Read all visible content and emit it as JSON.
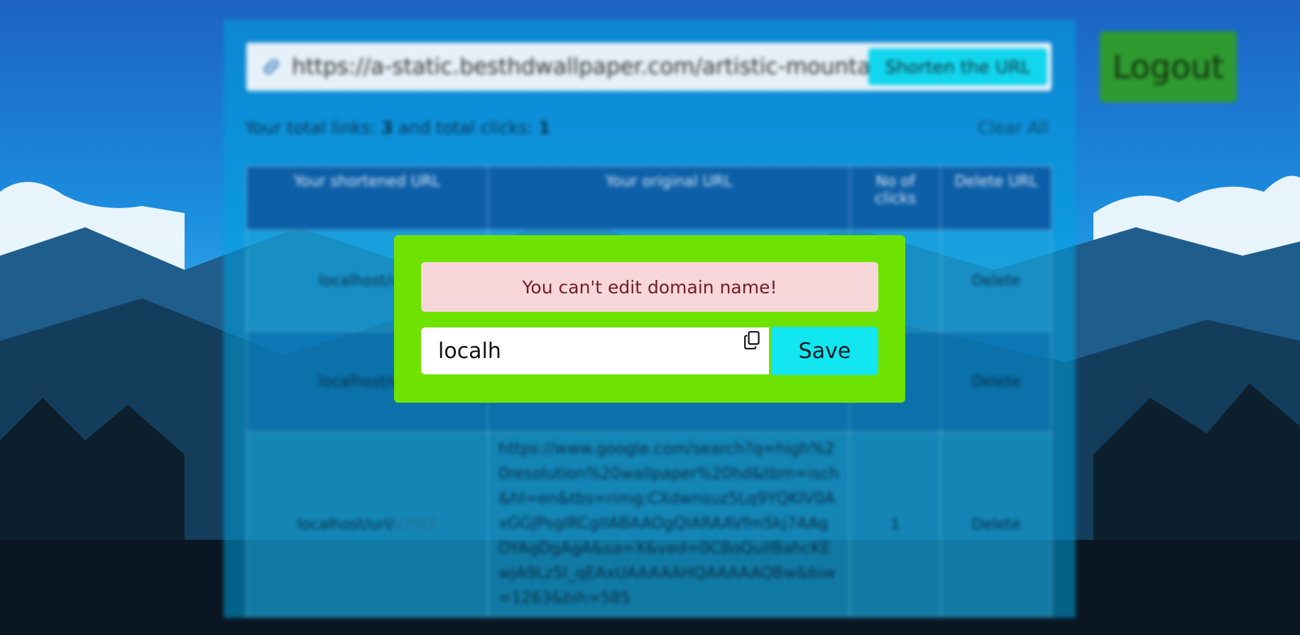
{
  "url_input": {
    "value": "https://a-static.besthdwallpaper.com/artistic-mountains"
  },
  "shorten_button_label": "Shorten the URL",
  "logout_label": "Logout",
  "stats": {
    "prefix": "Your total links: ",
    "links": "3",
    "middle": " and total clicks: ",
    "clicks": "1"
  },
  "clear_all_label": "Clear All",
  "table": {
    "headers": [
      "Your shortened URL",
      "Your original URL",
      "No of clicks",
      "Delete URL"
    ],
    "rows": [
      {
        "short_host": "localhost/url/",
        "short_code": "",
        "original": "",
        "clicks": "",
        "delete": "Delete"
      },
      {
        "short_host": "localhost/url/",
        "short_code": "",
        "original": "",
        "clicks": "",
        "delete": "Delete"
      },
      {
        "short_host": "localhost/url/",
        "short_code": "a75f2",
        "original": "https://www.google.com/search?q=high%20resolution%20wallpaper%20hd&tbm=isch&hl=en&tbs=rimg:CXdwnsuz5Lq9YQKIV0AxGGJPsgIRCgIIABAAOgQIARAAVfmSkj7AAgDYAgDgAgA&sa=X&ved=0CBoQuIIBahcKEwjA9Lz5I_qEAxUAAAAAHQAAAAAQBw&biw=1263&bih=585",
        "clicks": "1",
        "delete": "Delete"
      }
    ]
  },
  "modal": {
    "alert_text": "You can't edit domain name!",
    "input_value": "localh",
    "save_label": "Save"
  },
  "colors": {
    "modal_bg": "#6ee200",
    "alert_bg": "#f8d7da",
    "alert_text": "#721c24",
    "save_button": "#12e6f0",
    "shorten_button": "#12d6ee",
    "logout_button": "#2f9a2f"
  },
  "icons": [
    "link-icon",
    "copy-icon"
  ]
}
